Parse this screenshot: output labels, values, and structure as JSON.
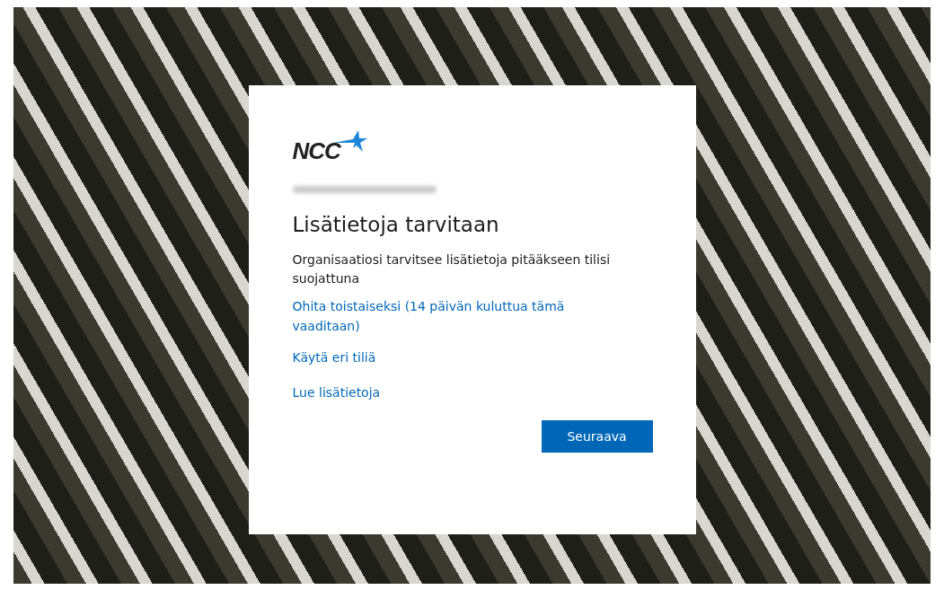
{
  "logo": {
    "text": "NCC"
  },
  "title": "Lisätietoja tarvitaan",
  "description": "Organisaatiosi tarvitsee lisätietoja pitääkseen tilisi suojattuna",
  "links": [
    {
      "label": "Ohita toistaiseksi (14 päivän kuluttua tämä vaaditaan)"
    },
    {
      "label": "Käytä eri tiliä"
    },
    {
      "label": "Lue lisätietoja"
    }
  ],
  "buttons": [
    {
      "label": "Seuraava",
      "kind": "primary"
    }
  ]
}
